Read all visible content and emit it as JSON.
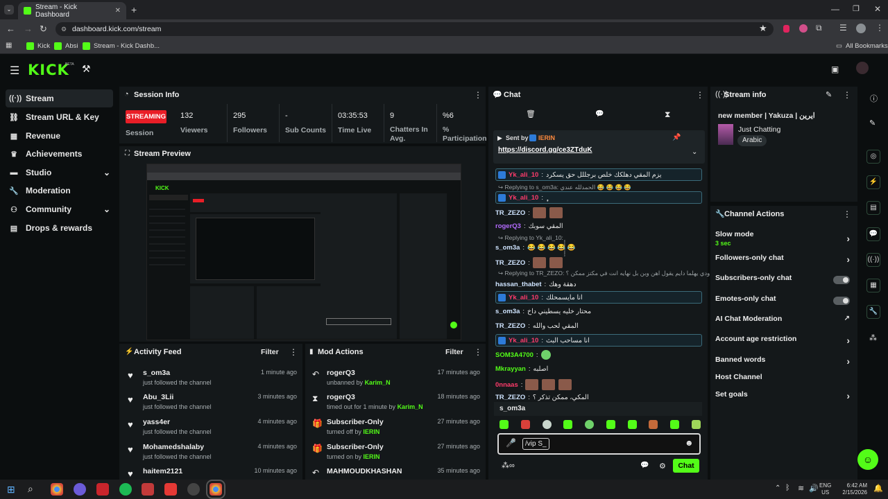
{
  "browser": {
    "tab_title": "Stream - Kick Dashboard",
    "url": "dashboard.kick.com/stream",
    "bookmarks": [
      "Kick",
      "Absi",
      "Stream - Kick Dashb..."
    ],
    "all_bookmarks": "All Bookmarks"
  },
  "app": {
    "logo": "KICK",
    "beta": "BETA"
  },
  "sidebar": {
    "items": [
      {
        "label": "Stream",
        "icon": "broadcast-icon",
        "active": true
      },
      {
        "label": "Stream URL & Key",
        "icon": "link-icon"
      },
      {
        "label": "Revenue",
        "icon": "revenue-icon"
      },
      {
        "label": "Achievements",
        "icon": "trophy-icon"
      },
      {
        "label": "Studio",
        "icon": "studio-icon",
        "expandable": true
      },
      {
        "label": "Moderation",
        "icon": "wrench-icon"
      },
      {
        "label": "Community",
        "icon": "community-icon",
        "expandable": true
      },
      {
        "label": "Drops & rewards",
        "icon": "drops-icon"
      }
    ]
  },
  "session": {
    "title": "Session Info",
    "status": "STREAMING",
    "status_label": "Session",
    "stats": [
      {
        "value": "132",
        "label": "Viewers"
      },
      {
        "value": "295",
        "label": "Followers"
      },
      {
        "value": "-",
        "label": "Sub Counts"
      },
      {
        "value": "03:35:53",
        "label": "Time Live"
      },
      {
        "value": "9",
        "label": "Chatters In Avg."
      },
      {
        "value": "%6",
        "label": "% Participation"
      }
    ]
  },
  "preview": {
    "title": "Stream Preview"
  },
  "activity": {
    "title": "Activity Feed",
    "filter": "Filter",
    "items": [
      {
        "name": "s_om3a",
        "sub": "just followed the channel",
        "time": "1 minute ago"
      },
      {
        "name": "Abu_3Lii",
        "sub": "just followed the channel",
        "time": "3 minutes ago"
      },
      {
        "name": "yass4er",
        "sub": "just followed the channel",
        "time": "4 minutes ago"
      },
      {
        "name": "Mohamedshalaby",
        "sub": "just followed the channel",
        "time": "4 minutes ago"
      },
      {
        "name": "haitem2121",
        "sub": "",
        "time": "10 minutes ago"
      }
    ]
  },
  "mod": {
    "title": "Mod Actions",
    "filter": "Filter",
    "items": [
      {
        "name": "rogerQ3",
        "sub": "unbanned by ",
        "by": "Karim_N",
        "time": "17 minutes ago",
        "icon": "undo-icon"
      },
      {
        "name": "rogerQ3",
        "sub": "timed out for 1 minute by ",
        "by": "Karim_N",
        "time": "18 minutes ago",
        "icon": "hourglass-icon"
      },
      {
        "name": "Subscriber-Only",
        "sub": "turned off by ",
        "by": "IERIN",
        "time": "27 minutes ago",
        "icon": "gift-icon"
      },
      {
        "name": "Subscriber-Only",
        "sub": "turned on by ",
        "by": "IERIN",
        "time": "27 minutes ago",
        "icon": "gift-icon"
      },
      {
        "name": "MAHMOUDKHASHAN",
        "sub": "",
        "by": "",
        "time": "35 minutes ago",
        "icon": "undo-icon"
      }
    ]
  },
  "chat": {
    "title": "Chat",
    "pinned": {
      "sent_by": "Sent by",
      "sender": "IERIN",
      "link": "https://discord.gg/ce3ZTduK"
    },
    "messages": [
      {
        "user": "Yk_ali_10",
        "color": "#ff3b6b",
        "text": "يزم المقي دهلكك خلص برجللل حق يسكرد",
        "hl": true
      },
      {
        "reply": "Replying to s_om3a: الحمدلله عندي 😂 😂 😂 😂"
      },
      {
        "user": "Yk_ali_10",
        "color": "#ff3b6b",
        "text": "ٕٕٕٕٕٕٕٕٕٕٕ",
        "hl": true
      },
      {
        "user": "TR_ZEZO",
        "color": "#cfe4ff",
        "emotes": 2
      },
      {
        "user": "rogerQ3",
        "color": "#b46bff",
        "text": "المقي سوبك"
      },
      {
        "reply": "Replying to Yk_ali_10: ٕٕٕٕٕٕٕٕٕٕٕ"
      },
      {
        "user": "s_om3a",
        "color": "#cfe4ff",
        "text": "😂 😂 😂 😂 😂"
      },
      {
        "user": "TR_ZEZO",
        "color": "#cfe4ff",
        "emotes": 2
      },
      {
        "reply": "Replying to TR_ZEZO: حب ودي يهلما دايم يقول اهن وبن بل نهايه انت في مكتز ممكن ؟"
      },
      {
        "user": "hassan_thabet",
        "color": "#cfe4ff",
        "text": "دهقة وهك"
      },
      {
        "user": "Yk_ali_10",
        "color": "#ff3b6b",
        "text": "انا مايسمحلك",
        "hl": true
      },
      {
        "user": "s_om3a",
        "color": "#cfe4ff",
        "text": "محتار خليه يسطيني داخ"
      },
      {
        "user": "TR_ZEZO",
        "color": "#cfe4ff",
        "text": "المقي لحب والله"
      },
      {
        "user": "Yk_ali_10",
        "color": "#ff3b6b",
        "text": "انا مساحب البث",
        "hl": true
      },
      {
        "user": "SOM3A4700",
        "color": "#53fc18",
        "emotes": 1
      },
      {
        "user": "Mkrayyan",
        "color": "#53fc18",
        "text": "اصلبه"
      },
      {
        "user": "0nnaas",
        "color": "#ff3b6b",
        "emotes": 3
      },
      {
        "user": "TR_ZEZO",
        "color": "#cfe4ff",
        "text": "المكي، ممكن تذكر ؟"
      }
    ],
    "typing_user": "s_om3a",
    "input_value": "/vip S_",
    "send": "Chat"
  },
  "stream_info": {
    "title": "Stream info",
    "stream_title": "new member | Yakuza | ايرين",
    "category": "Just Chatting",
    "tag": "Arabic"
  },
  "channel_actions": {
    "title": "Channel Actions",
    "items": [
      {
        "label": "Slow mode",
        "sub": "3 sec",
        "control": "chevron"
      },
      {
        "label": "Followers-only chat",
        "control": "chevron"
      },
      {
        "label": "Subscribers-only chat",
        "control": "toggle"
      },
      {
        "label": "Emotes-only chat",
        "control": "toggle"
      },
      {
        "label": "AI Chat Moderation",
        "control": "external"
      },
      {
        "label": "Account age restriction",
        "control": "chevron"
      },
      {
        "label": "Banned words",
        "control": "chevron"
      },
      {
        "label": "Host Channel",
        "control": "none"
      },
      {
        "label": "Set goals",
        "control": "chevron"
      }
    ]
  },
  "taskbar": {
    "lang": "ENG",
    "region": "US",
    "time": "6:42 AM",
    "date": "2/15/2026"
  },
  "colors": {
    "accent": "#53fc18",
    "streaming": "#e91e27",
    "panel": "#14181a",
    "bg": "#0b0e0f"
  }
}
